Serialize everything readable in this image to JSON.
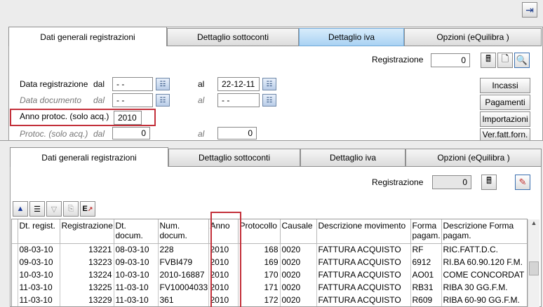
{
  "topbar": {
    "exit_icon": "exit-door-icon"
  },
  "tabs": [
    "Dati generali registrazioni",
    "Dettaglio sottoconti",
    "Dettaglio iva",
    "Opzioni (eQuilibra )"
  ],
  "top_form": {
    "registrazione_label": "Registrazione",
    "registrazione_value": "0",
    "data_reg_label": "Data registrazione",
    "dal_label": "dal",
    "al_label": "al",
    "data_reg_dal": "- -",
    "data_reg_al": "22-12-11",
    "data_doc_label": "Data documento",
    "data_doc_dal": "- -",
    "data_doc_al": "- -",
    "anno_protoc_label": "Anno protoc. (solo acq.)",
    "anno_protoc_value": "2010",
    "protoc_label": "Protoc. (solo acq.)",
    "protoc_dal": "0",
    "protoc_al": "0",
    "side_buttons": [
      "Incassi",
      "Pagamenti",
      "Importazioni",
      "Ver.fatt.forn."
    ]
  },
  "bottom_form": {
    "registrazione_label": "Registrazione",
    "registrazione_value": "0"
  },
  "grid": {
    "columns": [
      "Dt. regist.",
      "Registrazione",
      "Dt. docum.",
      "Num. docum.",
      "Anno",
      "Protocollo",
      "Causale",
      "Descrizione movimento",
      "Forma pagam.",
      "Descrizione Forma pagam."
    ],
    "rows": [
      [
        "08-03-10",
        "13221",
        "08-03-10",
        "228",
        "2010",
        "168",
        "0020",
        "FATTURA ACQUISTO",
        "RF",
        "RIC.FATT.D.C."
      ],
      [
        "09-03-10",
        "13223",
        "09-03-10",
        "FVBI479",
        "2010",
        "169",
        "0020",
        "FATTURA ACQUISTO",
        "6912",
        "RI.BA 60.90.120 F.M."
      ],
      [
        "10-03-10",
        "13224",
        "10-03-10",
        "2010-16887",
        "2010",
        "170",
        "0020",
        "FATTURA ACQUISTO",
        "AO01",
        "COME CONCORDAT"
      ],
      [
        "11-03-10",
        "13225",
        "11-03-10",
        "FV10004033",
        "2010",
        "171",
        "0020",
        "FATTURA ACQUISTO",
        "RB31",
        "RIBA 30 GG.F.M."
      ],
      [
        "11-03-10",
        "13229",
        "11-03-10",
        "361",
        "2010",
        "172",
        "0020",
        "FATTURA ACQUISTO",
        "R609",
        "RIBA 60-90 GG.F.M."
      ]
    ]
  }
}
